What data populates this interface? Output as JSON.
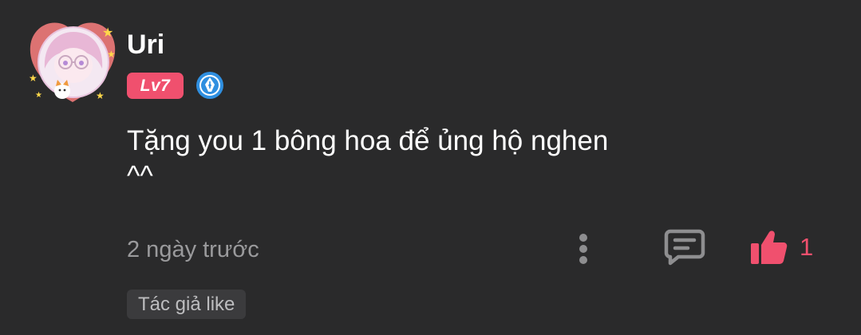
{
  "comment": {
    "username": "Uri",
    "level": "Lv7",
    "text_line1": "Tặng you 1 bông hoa để ủng hộ nghen",
    "text_line2": "^^",
    "timestamp": "2 ngày trước",
    "like_count": "1",
    "author_like_tag": "Tác giả like"
  },
  "icons": {
    "badge": "pen-nib-badge-icon",
    "more": "vertical-dots-icon",
    "reply": "comment-bubble-icon",
    "like": "thumbs-up-icon"
  },
  "colors": {
    "background": "#2a2a2b",
    "accent": "#f0506e",
    "muted_text": "#9a9a9c",
    "icon_gray": "#8e8e90",
    "badge_blue": "#2f8fe0"
  }
}
